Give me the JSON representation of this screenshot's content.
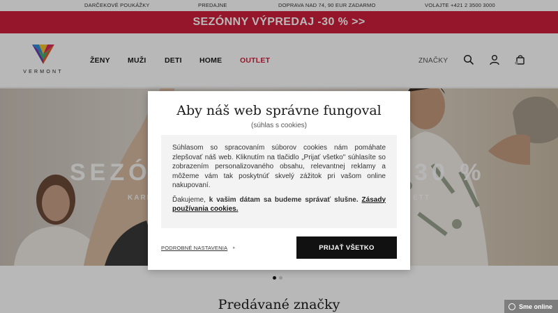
{
  "topbar": {
    "gift_cards": "DARČEKOVÉ POUKÁŽKY",
    "stores": "PREDAJNE",
    "shipping": "DOPRAVA NAD 74, 90 EUR ZADARMO",
    "phone": "VOLAJTE +421 2 3500 3000"
  },
  "promo": {
    "text": "SEZÓNNY VÝPREDAJ -30 % >>",
    "color": "#cf1f3b"
  },
  "header": {
    "logo_text": "VERMONT",
    "nav": [
      "ŽENY",
      "MUŽI",
      "DETI",
      "HOME",
      "OUTLET"
    ],
    "brands": "ZNAČKY",
    "icons": [
      "search-icon",
      "user-icon",
      "bag-icon"
    ]
  },
  "hero": {
    "left_text": "SEZÓ",
    "right_text": "30 %",
    "left_sub": "KARL",
    "right_sub": "ETT",
    "dots": 2,
    "active_dot": 0
  },
  "section": {
    "title": "Predávané značky"
  },
  "chat": {
    "label": "Sme online"
  },
  "cookie_modal": {
    "title": "Aby náš web správne fungoval",
    "subtitle": "(súhlas s cookies)",
    "body": "Súhlasom so spracovaním súborov cookies nám pomáhate zlepšovať náš web. Kliknutím na tlačidlo „Prijať všetko\" súhlasíte so zobrazením personalizovaného obsahu, relevantnej reklamy a môžeme vám tak poskytnúť skvelý zážitok pri vašom online nakupovaní.",
    "thanks_prefix": "Ďakujeme, ",
    "thanks_bold": "k vašim dátam sa budeme správať slušne.",
    "policy_link": "Zásady používania cookies.",
    "settings_link": "PODROBNÉ NASTAVENIA",
    "accept_button": "PRIJAŤ VŠETKO"
  }
}
